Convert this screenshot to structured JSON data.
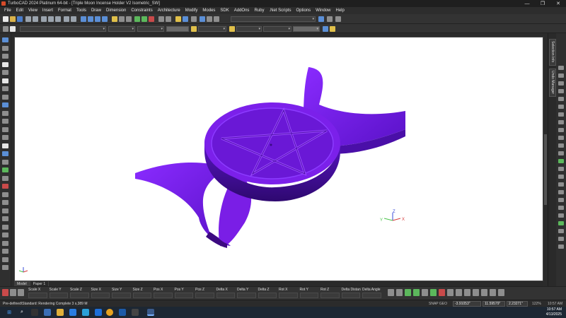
{
  "window": {
    "title": "TurboCAD 2024 Platinum 64-bit - [Triple Moon Incense Holder V2 Isometric_SW]",
    "minimize": "—",
    "restore": "❐",
    "close": "✕"
  },
  "menu": [
    "File",
    "Edit",
    "View",
    "Insert",
    "Format",
    "Tools",
    "Draw",
    "Dimension",
    "Constraints",
    "Architecture",
    "Modify",
    "Modes",
    "SDK",
    "AddOns",
    "Ruby",
    ".Net Scripts",
    "Options",
    "Window",
    "Help"
  ],
  "side_tabs": {
    "selection_info": "Selection Info",
    "undo_manager": "Undo Manager"
  },
  "model_tabs": [
    "Model",
    "Paper 1"
  ],
  "measure_fields": [
    "Scale X",
    "Scale Y",
    "Scale Z",
    "Size X",
    "Size Y",
    "Size Z",
    "Pos X",
    "Pos Y",
    "Pos Z",
    "Delta X",
    "Delta Y",
    "Delta Z",
    "Rot X",
    "Rot Y",
    "Rot Z",
    "Delta Distan",
    "Delta Angle"
  ],
  "status": {
    "text": "Pre-defined\\Standard: Rendering Complete 3 s,389 M",
    "snap_label": "SNAP GEO",
    "x_value": "-3.91053\"",
    "y_value": "11.59579\"",
    "z_value": "2.23271\"",
    "zoom": "122%",
    "time_right": "10:57 AM"
  },
  "taskbar": {
    "time": "10:57 AM",
    "date": "4/13/2025"
  },
  "axis_labels": {
    "x": "X",
    "y": "Y",
    "z": "Z"
  },
  "colors": {
    "model_purple": "#7a1ee6",
    "model_dark": "#3c0a80",
    "model_light": "#9d3dff",
    "canvas_bg": "#ffffff",
    "app_chrome": "#2b2b2b"
  }
}
